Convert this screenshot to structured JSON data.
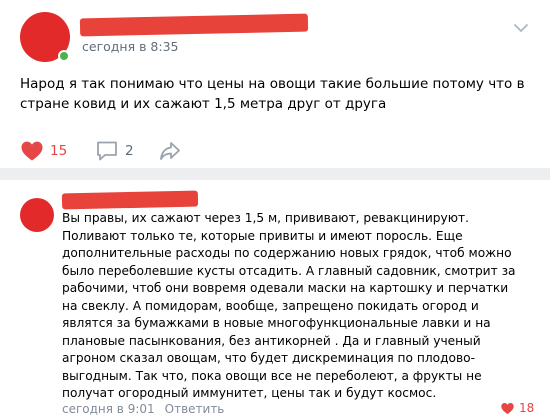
{
  "post": {
    "time": "сегодня в 8:35",
    "text": "Народ я так понимаю что цены на овощи такие большие потому что в стране ковид и их сажают 1,5 метра друг от друга",
    "likes": "15",
    "comments": "2"
  },
  "comment": {
    "text": "Вы правы, их сажают через 1,5 м, прививают, ревакцинируют. Поливают только те, которые привиты и имеют поросль. Еще дополнительные расходы по содержанию новых грядок, чтоб можно было переболевшие кусты отсадить. А главный садовник, смотрит за рабочими, чтоб они вовремя одевали маски на картошку и перчатки на свеклу. А помидорам, вообще, запрещено покидать огород и являтся за бумажками в новые многофункциональные лавки и на плановые пасынкования, без антикорней . Да и главный ученый агроном сказал овощам, что будет дискреминация по плодово-выгодным. Так что, пока овощи все не переболеют, а фрукты не получат огородный иммунитет, цены так и будут космос.",
    "time": "сегодня в 9:01",
    "reply_label": "Ответить",
    "likes": "18"
  },
  "colors": {
    "background": "#edeef0",
    "card": "#ffffff",
    "like_red": "#e64646",
    "avatar_red": "#e32a2a",
    "muted": "#818c99"
  },
  "icons": [
    "heart-icon",
    "comment-icon",
    "share-icon",
    "chevron-down-icon"
  ]
}
